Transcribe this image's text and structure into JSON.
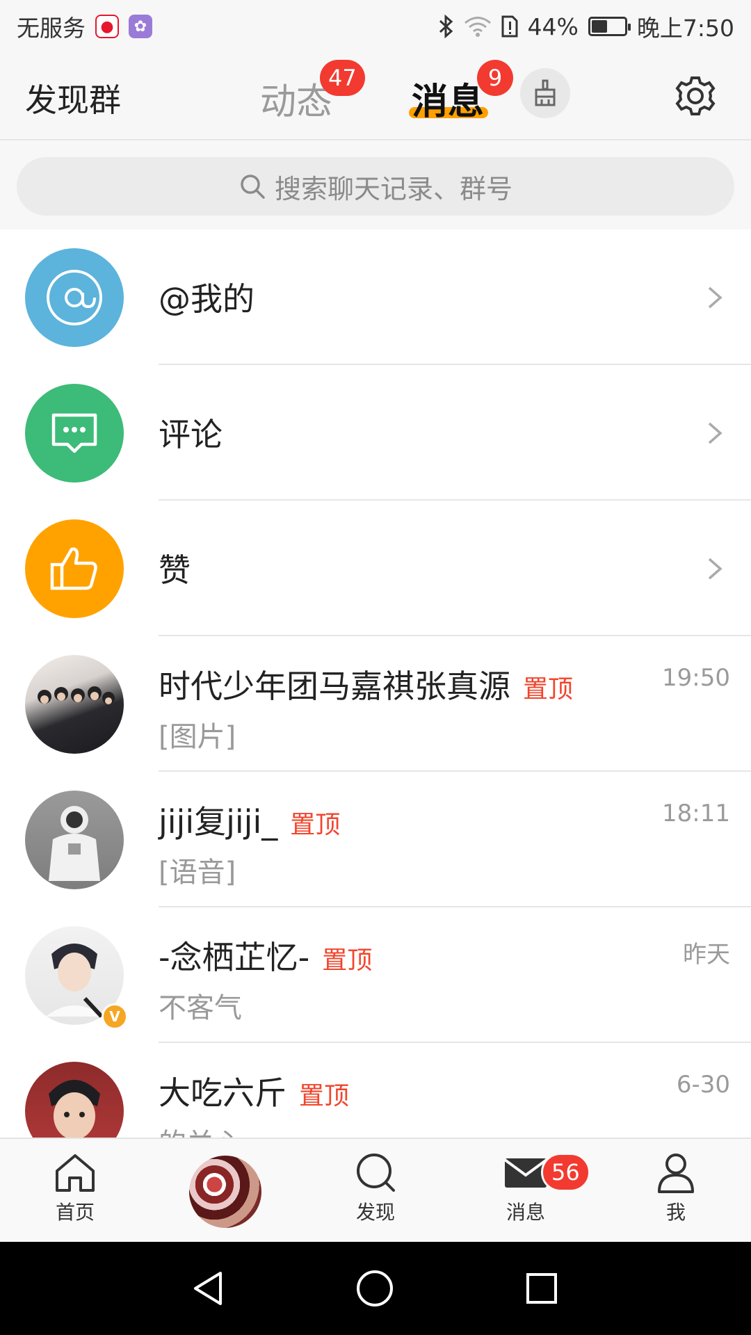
{
  "status_bar": {
    "carrier": "无服务",
    "battery_percent": "44%",
    "battery_level": 0.44,
    "time": "晚上7:50"
  },
  "top_nav": {
    "left_label": "发现群",
    "tabs": [
      {
        "label": "动态",
        "badge": "47",
        "active": false
      },
      {
        "label": "消息",
        "badge": "9",
        "active": true
      }
    ],
    "accent_color": "#ffa000"
  },
  "search": {
    "placeholder": "搜索聊天记录、群号"
  },
  "categories": [
    {
      "label": "@我的",
      "icon": "at-icon",
      "color": "#5cb3dc"
    },
    {
      "label": "评论",
      "icon": "comment-icon",
      "color": "#3dbb78"
    },
    {
      "label": "赞",
      "icon": "thumbs-up-icon",
      "color": "#ffa200"
    }
  ],
  "chats": [
    {
      "name": "时代少年团马嘉祺张真源",
      "pin": "置顶",
      "time": "19:50",
      "preview": "[图片]"
    },
    {
      "name": "jiji复jiji_",
      "pin": "置顶",
      "time": "18:11",
      "preview": "[语音]"
    },
    {
      "name": "-念栖芷忆-",
      "pin": "置顶",
      "time": "昨天",
      "preview": "不客气",
      "verified": "V"
    },
    {
      "name": "大吃六斤",
      "pin": "置顶",
      "time": "6-30",
      "preview": "的关心"
    }
  ],
  "bottom_nav": {
    "items": [
      {
        "label": "首页",
        "icon": "home-icon"
      },
      {
        "label": "",
        "icon": "avatar-center"
      },
      {
        "label": "发现",
        "icon": "search-icon"
      },
      {
        "label": "消息",
        "icon": "mail-icon",
        "badge": "56"
      },
      {
        "label": "我",
        "icon": "person-icon"
      }
    ]
  },
  "colors": {
    "badge": "#f23a30",
    "pin": "#f1452c"
  }
}
